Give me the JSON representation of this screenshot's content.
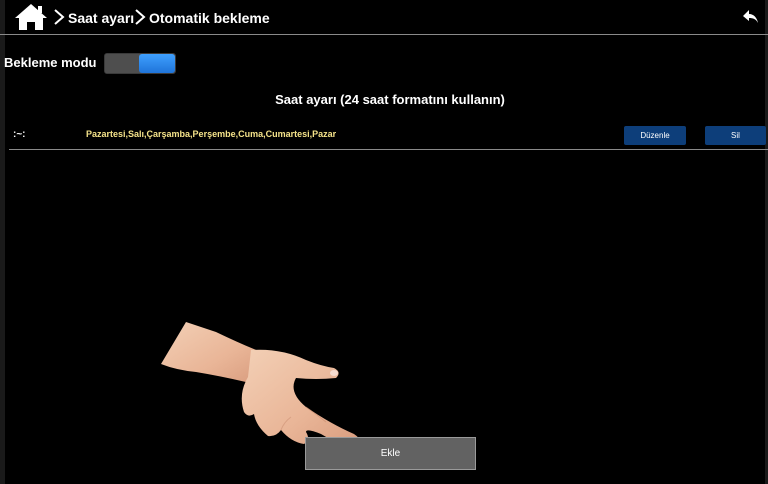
{
  "header": {
    "home_icon": "home-icon",
    "breadcrumb_1": "Saat ayarı",
    "breadcrumb_2": "Otomatik bekleme",
    "separator_icon": "chevron-right-icon",
    "back_icon": "back-arrow-icon"
  },
  "mode": {
    "label": "Bekleme modu",
    "toggle_state": "on"
  },
  "section_title": "Saat ayarı (24 saat formatını kullanın)",
  "schedule": {
    "rows": [
      {
        "time": ":~:",
        "days": "Pazartesi,Salı,Çarşamba,Perşembe,Cuma,Cumartesi,Pazar",
        "edit_label": "Düzenle",
        "delete_label": "Sil"
      }
    ]
  },
  "add_button_label": "Ekle",
  "colors": {
    "background": "#000000",
    "toggle_on": "#2f8df0",
    "button_blue": "#0d3e7a",
    "days_text": "#f5e38a",
    "add_button": "#626262"
  }
}
